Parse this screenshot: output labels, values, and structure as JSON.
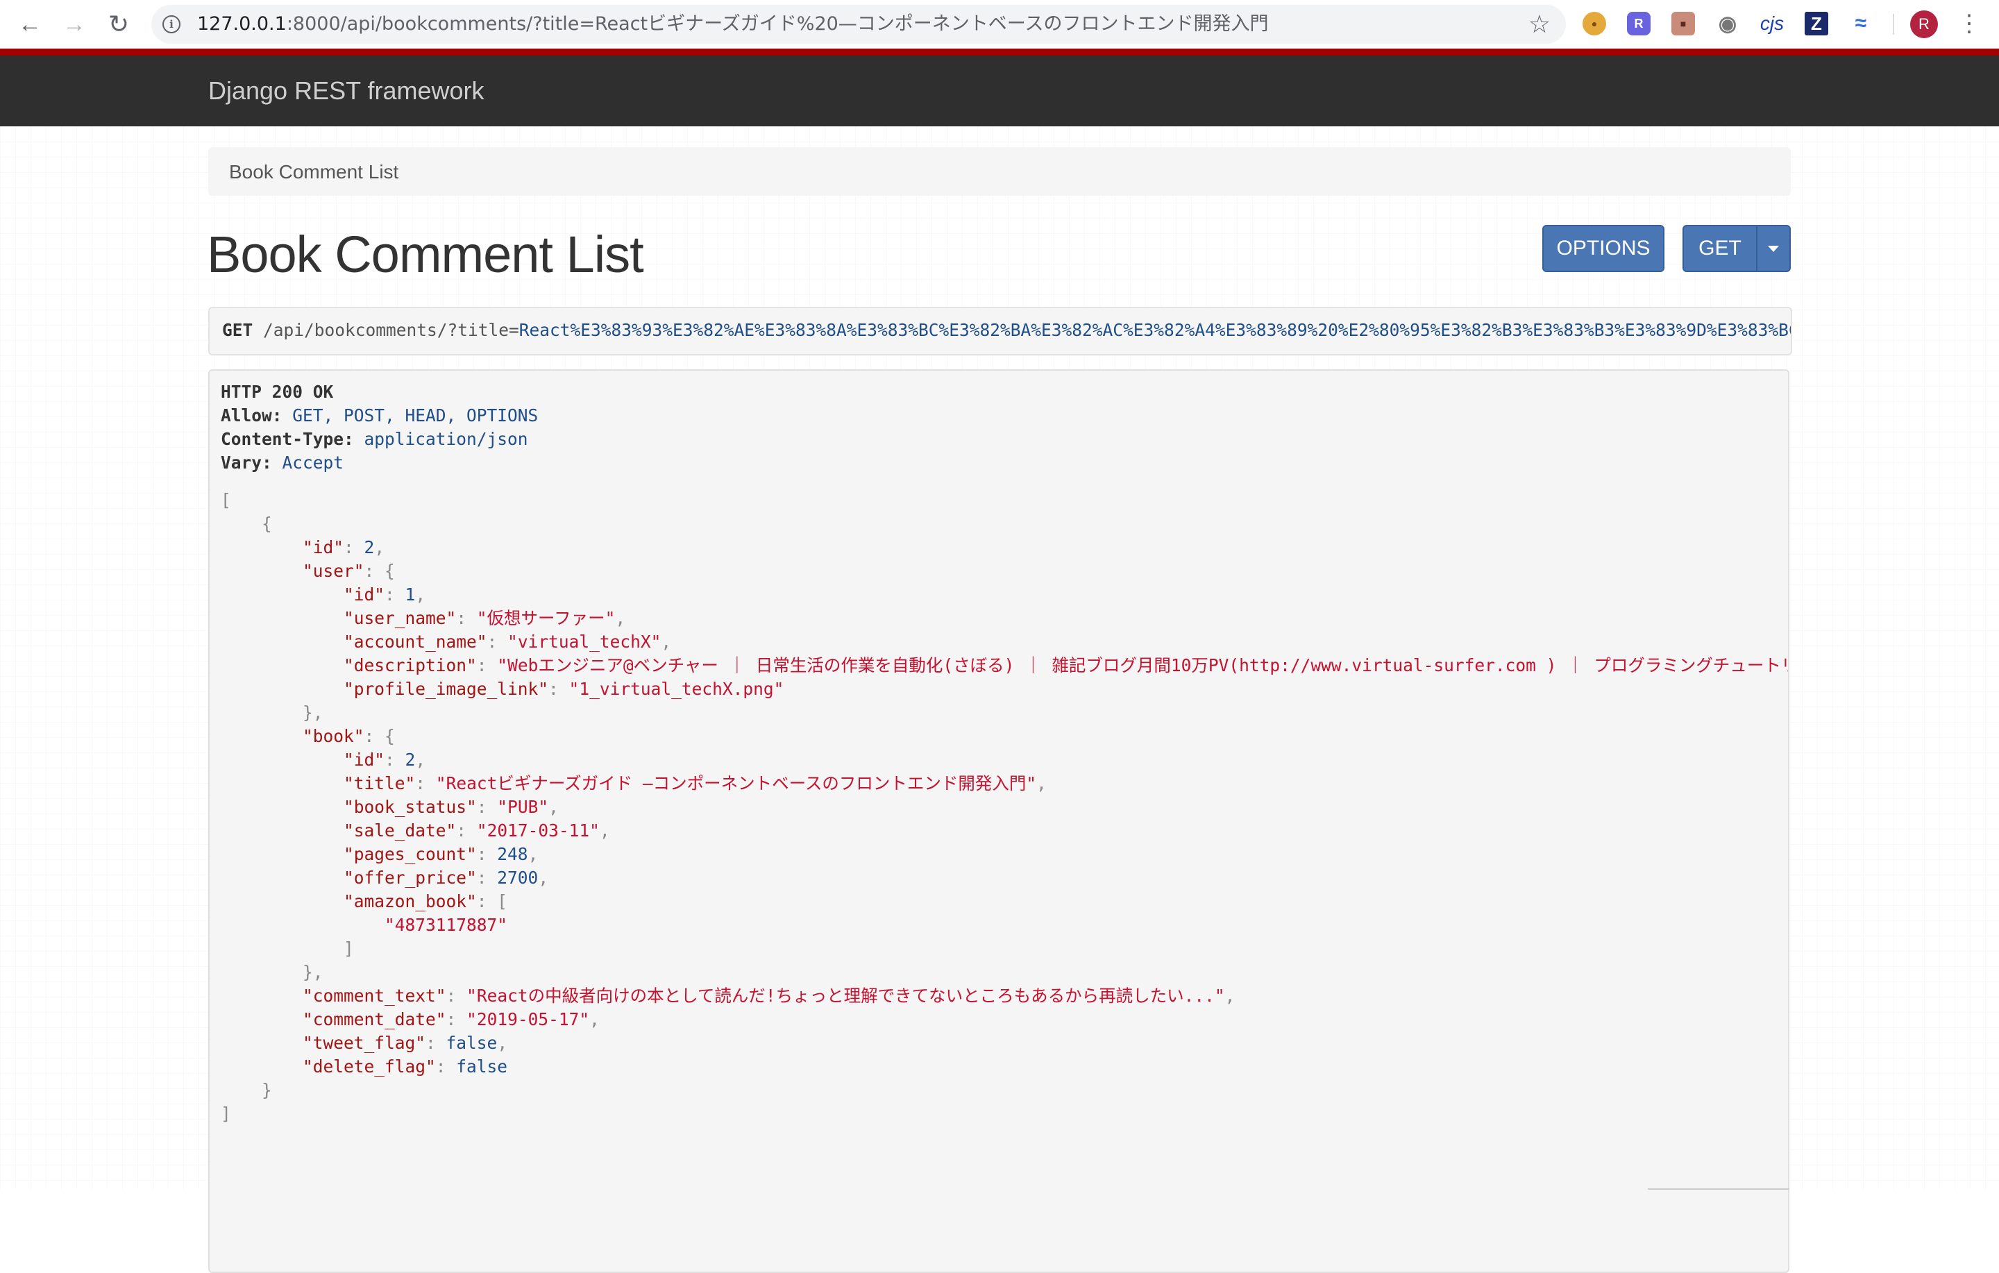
{
  "browser": {
    "url_host": "127.0.0.1",
    "url_rest": ":8000/api/bookcomments/?title=Reactビギナーズガイド%20—コンポーネントベースのフロントエンド開発入門",
    "avatar_letter": "R",
    "extensions": [
      "cookie-icon",
      "r-extension-icon",
      "face-extension-icon",
      "camera-icon",
      "cjs",
      "z-extension-icon",
      "wave-extension-icon"
    ],
    "ext_cjs_label": "cjs",
    "ext_z_label": "Z",
    "ext_r_label": "R"
  },
  "navbar": {
    "brand": "Django REST framework"
  },
  "breadcrumb": {
    "current": "Book Comment List"
  },
  "page": {
    "title": "Book Comment List"
  },
  "buttons": {
    "options": "OPTIONS",
    "get": "GET"
  },
  "request": {
    "method": "GET",
    "path": "/api/bookcomments/?title=",
    "query": "React%E3%83%93%E3%82%AE%E3%83%8A%E3%83%BC%E3%82%BA%E3%82%AC%E3%82%A4%E3%83%89%20%E2%80%95%E3%82%B3%E3%83%B3%E3%83%9D%E3%83%BC%E3"
  },
  "response": {
    "status": "HTTP 200 OK",
    "headers": [
      {
        "key": "Allow:",
        "value": "GET, POST, HEAD, OPTIONS"
      },
      {
        "key": "Content-Type:",
        "value": "application/json"
      },
      {
        "key": "Vary:",
        "value": "Accept"
      }
    ],
    "body": {
      "id": "2",
      "user": {
        "id": "1",
        "user_name": "仮想サーファー",
        "account_name": "virtual_techX",
        "description": "Webエンジニア@ベンチャー ｜ 日常生活の作業を自動化(さぼる) ｜ 雑記ブログ月間10万PV(http://www.virtual-surfer.com ) ｜ プログラミングチュートリアル(https:/",
        "profile_image_link": "1_virtual_techX.png"
      },
      "book": {
        "id": "2",
        "title": "Reactビギナーズガイド ―コンポーネントベースのフロントエンド開発入門",
        "book_status": "PUB",
        "sale_date": "2017-03-11",
        "pages_count": "248",
        "offer_price": "2700",
        "amazon_book": [
          "4873117887"
        ]
      },
      "comment_text": "Reactの中級者向けの本として読んだ!ちょっと理解できてないところもあるから再読したい...",
      "comment_date": "2019-05-17",
      "tweet_flag": "false",
      "delete_flag": "false"
    }
  },
  "colors": {
    "navbar": "#2f2f2f",
    "accent_strip": "#a30000",
    "button": "#4a77b4",
    "json_string": "#c4122f",
    "json_number": "#1f4e8a"
  }
}
